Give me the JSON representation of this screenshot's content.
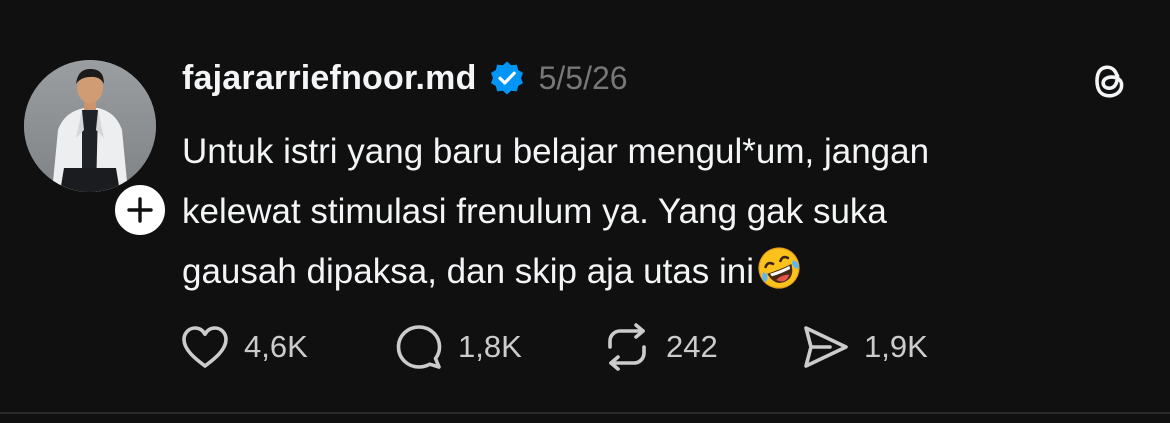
{
  "post": {
    "username": "fajararriefnoor.md",
    "verified": true,
    "timestamp": "5/5/26",
    "text": "Untuk istri yang baru belajar mengul*um, jangan\nkelewat stimulasi frenulum ya. Yang gak suka\ngausah dipaksa, dan skip aja utas ini",
    "emoji": "rolling-on-the-floor-laughing",
    "actions": {
      "likes": "4,6K",
      "replies": "1,8K",
      "reposts": "242",
      "shares": "1,9K"
    }
  },
  "icons": {
    "like": "heart-icon",
    "reply": "speech-bubble-icon",
    "repost": "repost-arrows-icon",
    "share": "paper-plane-icon",
    "app": "threads-logo-icon",
    "follow": "plus-icon",
    "verified": "verified-badge-icon"
  },
  "colors": {
    "background": "#101010",
    "text": "#f3f5f7",
    "secondary_text": "#777777",
    "verified_blue": "#0095f6"
  }
}
